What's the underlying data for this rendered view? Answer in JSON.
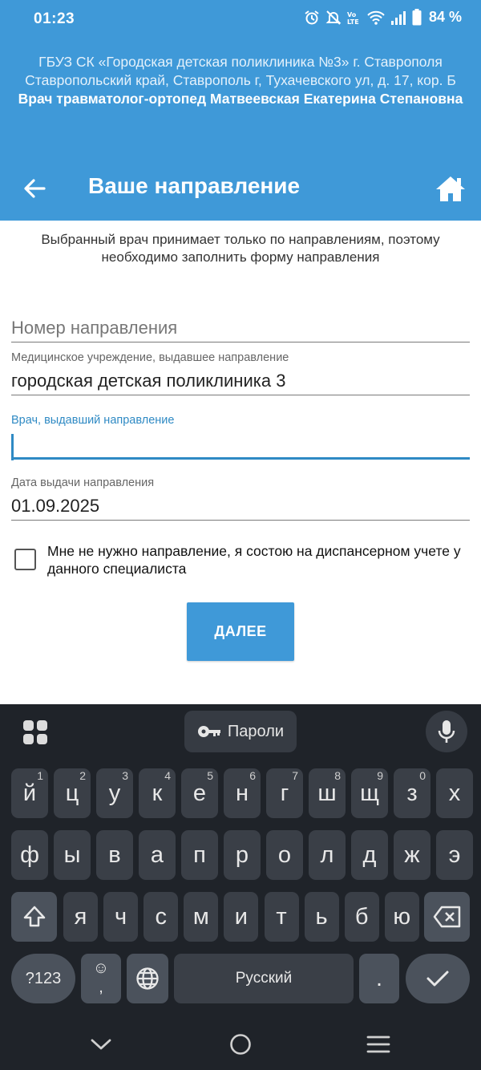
{
  "status_bar": {
    "time": "01:23",
    "battery": "84 %"
  },
  "header": {
    "clinic_name": "ГБУЗ СК «Городская детская поликлиника №3» г. Ставрополя",
    "address": "Ставропольский край, Ставрополь г, Тухачевского ул, д. 17, кор. Б",
    "doctor": "Врач травматолог-ортопед Матвеевская Екатерина Степановна",
    "title": "Ваше направление"
  },
  "form": {
    "info_text": "Выбранный врач принимает только по направлениям, поэтому необходимо заполнить форму направления",
    "referral_number": {
      "placeholder": "Номер направления",
      "value": ""
    },
    "institution": {
      "label": "Медицинское учреждение, выдавшее направление",
      "value": "городская детская поликлиника 3"
    },
    "doctor_field": {
      "label": "Врач, выдавший направление",
      "value": ""
    },
    "date": {
      "label": "Дата выдачи направления",
      "value": "01.09.2025"
    },
    "checkbox_label": "Мне не нужно направление, я состою на диспансерном учете у данного специалиста",
    "checkbox_checked": false,
    "next_button": "ДАЛЕЕ"
  },
  "keyboard": {
    "passwords_label": "Пароли",
    "row1": [
      {
        "k": "й",
        "h": "1"
      },
      {
        "k": "ц",
        "h": "2"
      },
      {
        "k": "у",
        "h": "3"
      },
      {
        "k": "к",
        "h": "4"
      },
      {
        "k": "е",
        "h": "5"
      },
      {
        "k": "н",
        "h": "6"
      },
      {
        "k": "г",
        "h": "7"
      },
      {
        "k": "ш",
        "h": "8"
      },
      {
        "k": "щ",
        "h": "9"
      },
      {
        "k": "з",
        "h": "0"
      },
      {
        "k": "х",
        "h": ""
      }
    ],
    "row2": [
      "ф",
      "ы",
      "в",
      "а",
      "п",
      "р",
      "о",
      "л",
      "д",
      "ж",
      "э"
    ],
    "row3": [
      "я",
      "ч",
      "с",
      "м",
      "и",
      "т",
      "ь",
      "б",
      "ю"
    ],
    "symbols_label": "?123",
    "emoji_label": "☺,",
    "space_label": "Русский",
    "period_label": "."
  },
  "colors": {
    "primary": "#3f99d8",
    "accent": "#2f8ac4",
    "keyboard_bg": "#1f2329",
    "key_bg": "#3a3f47"
  }
}
